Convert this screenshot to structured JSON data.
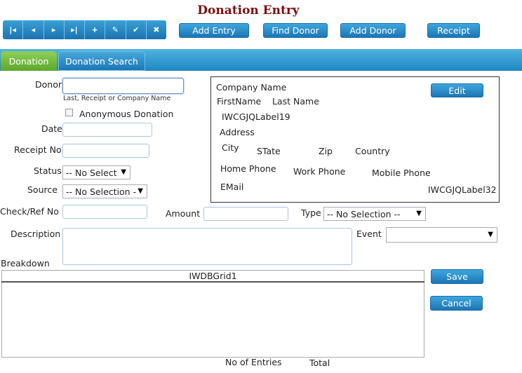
{
  "page_title": "Donation Entry",
  "nav_buttons": [
    {
      "name": "first-record",
      "glyph": "|◂"
    },
    {
      "name": "previous-record",
      "glyph": "◂"
    },
    {
      "name": "next-record",
      "glyph": "▸"
    },
    {
      "name": "last-record",
      "glyph": "▸|"
    },
    {
      "name": "add-record",
      "glyph": "+"
    },
    {
      "name": "edit-record",
      "glyph": "✎"
    },
    {
      "name": "confirm-record",
      "glyph": "✔"
    },
    {
      "name": "cancel-record",
      "glyph": "✖"
    }
  ],
  "toolbar": {
    "add_entry": "Add Entry",
    "find_donor": "Find Donor",
    "add_donor": "Add Donor",
    "receipt": "Receipt"
  },
  "tabs": {
    "donation": "Donation",
    "donation_search": "Donation Search"
  },
  "form": {
    "donor_label": "Donor",
    "donor_hint": "Last, Receipt or Company Name",
    "anonymous_label": "Anonymous Donation",
    "date_label": "Date",
    "receipt_no_label": "Receipt No",
    "status_label": "Status",
    "status_value": "-- No Select",
    "source_label": "Source",
    "source_value": "-- No Selection -",
    "check_ref_label": "Check/Ref No",
    "amount_label": "Amount",
    "type_label": "Type",
    "type_value": "-- No Selection --",
    "description_label": "Description",
    "event_label": "Event",
    "event_value": "",
    "breakdown_label": "Breakdown"
  },
  "donor_info": {
    "company_name": "Company Name",
    "edit_button": "Edit",
    "first_name": "FirstName",
    "last_name": "Last Name",
    "label19": "IWCGJQLabel19",
    "address": "Address",
    "city": "City",
    "state": "STate",
    "zip": "Zip",
    "country": "Country",
    "home_phone": "Home Phone",
    "work_phone": "Work Phone",
    "mobile_phone": "Mobile Phone",
    "email": "EMail",
    "label32": "IWCGJQLabel32"
  },
  "grid": {
    "header": "IWDBGrid1",
    "no_of_entries_label": "No of Entries",
    "total_label": "Total"
  },
  "side_buttons": {
    "save": "Save",
    "cancel": "Cancel"
  }
}
